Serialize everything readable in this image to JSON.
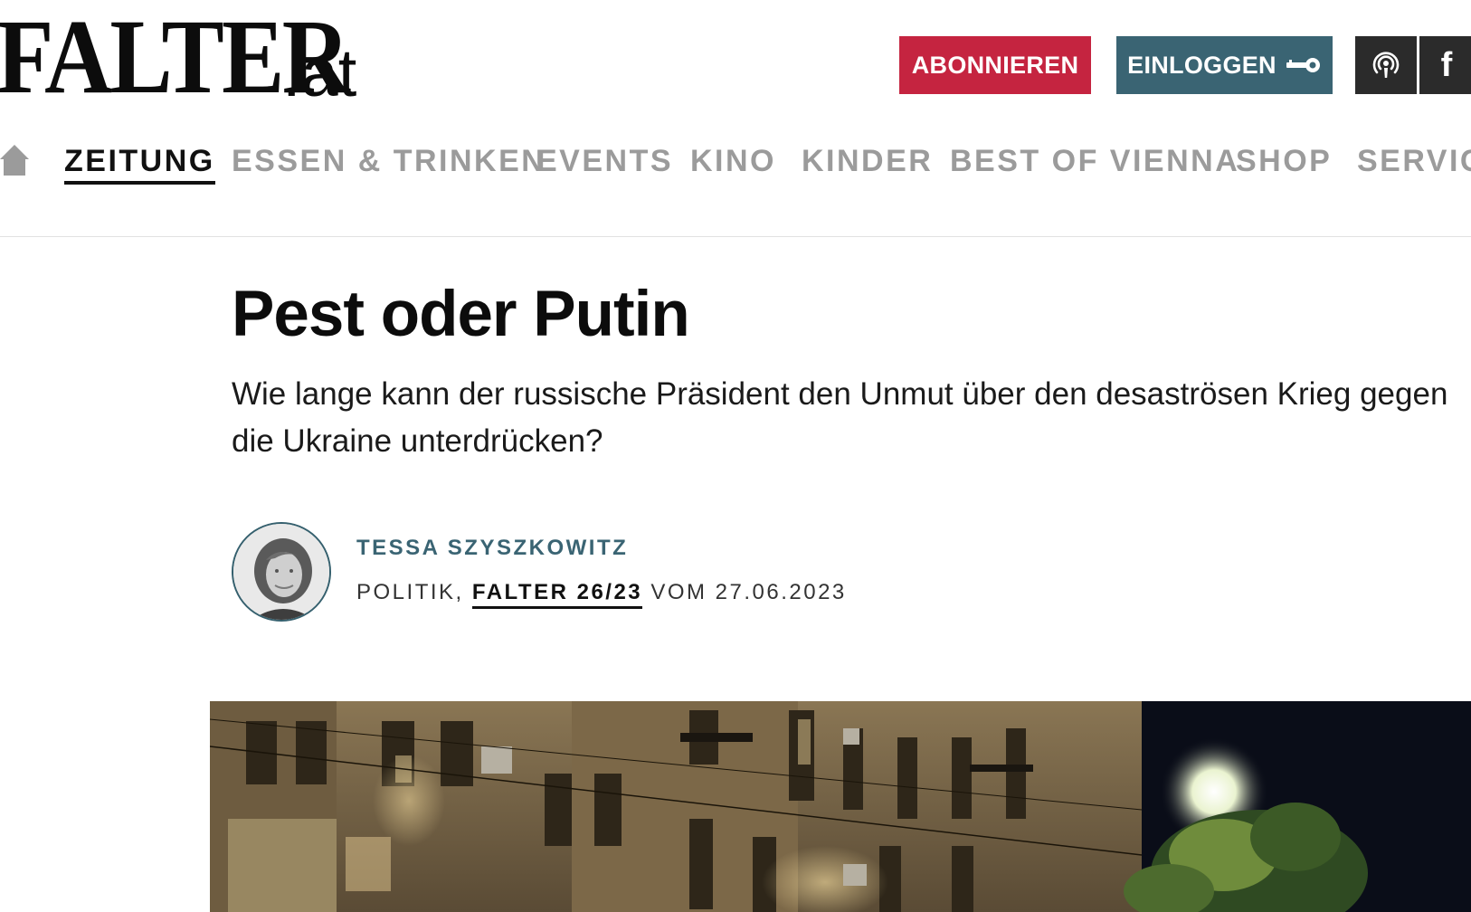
{
  "header": {
    "logo_main": "FALTER",
    "logo_suffix": ".at",
    "subscribe_label": "ABONNIEREN",
    "login_label": "EINLOGGEN",
    "podcast_icon": "podcast-icon",
    "facebook_icon": "facebook-icon",
    "facebook_glyph": "f"
  },
  "nav": {
    "home_icon": "home-icon",
    "items": [
      {
        "label": "ZEITUNG",
        "active": true
      },
      {
        "label": "ESSEN & TRINKEN",
        "active": false
      },
      {
        "label": "EVENTS",
        "active": false
      },
      {
        "label": "KINO",
        "active": false
      },
      {
        "label": "KINDER",
        "active": false
      },
      {
        "label": "BEST OF VIENNA",
        "active": false
      },
      {
        "label": "SHOP",
        "active": false
      },
      {
        "label": "SERVICE",
        "active": false
      }
    ]
  },
  "article": {
    "title": "Pest oder Putin",
    "lead": "Wie lange kann der russische Präsident den Unmut über den desaströsen Krieg gegen die Ukraine unterdrücken?",
    "author": "TESSA SZYSZKOWITZ",
    "section": "POLITIK,",
    "issue": "FALTER 26/23",
    "date_text": "VOM 27.06.2023"
  },
  "colors": {
    "subscribe_bg": "#c52440",
    "login_bg": "#3a6473",
    "icon_btn_bg": "#2b2b2b",
    "nav_inactive": "#9b9b9b",
    "author_color": "#3a6473"
  }
}
